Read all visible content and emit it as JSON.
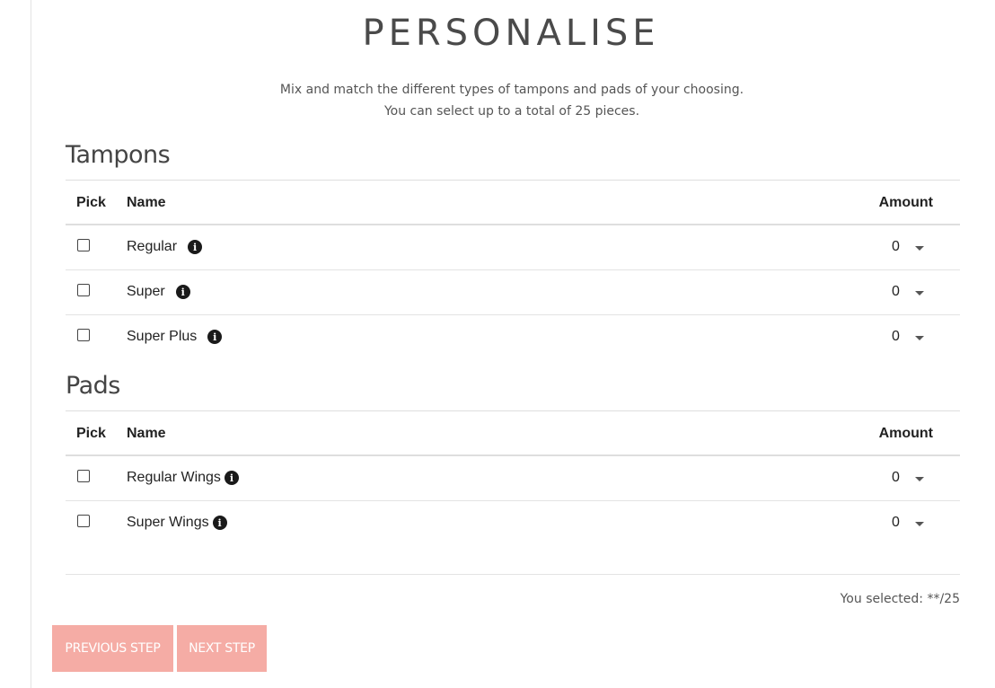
{
  "header": {
    "title": "PERSONALISE",
    "subtitle_line1": "Mix and match the different types of tampons and pads of your choosing.",
    "subtitle_line2": "You can select up to a total of 25 pieces."
  },
  "columns": {
    "pick": "Pick",
    "name": "Name",
    "amount": "Amount"
  },
  "sections": [
    {
      "title": "Tampons",
      "items": [
        {
          "name": "Regular",
          "amount": "0",
          "checked": false
        },
        {
          "name": "Super",
          "amount": "0",
          "checked": false
        },
        {
          "name": "Super Plus",
          "amount": "0",
          "checked": false
        }
      ]
    },
    {
      "title": "Pads",
      "items": [
        {
          "name": "Regular Wings",
          "amount": "0",
          "checked": false
        },
        {
          "name": "Super Wings",
          "amount": "0",
          "checked": false
        }
      ]
    }
  ],
  "footer": {
    "selected_text": "You selected: **/25",
    "prev_label": "PREVIOUS STEP",
    "next_label": "NEXT STEP"
  },
  "colors": {
    "button_bg": "#f5aca5",
    "button_text": "#ffffff"
  },
  "icons": {
    "info": "info-circle-icon",
    "dropdown": "caret-down-icon"
  }
}
